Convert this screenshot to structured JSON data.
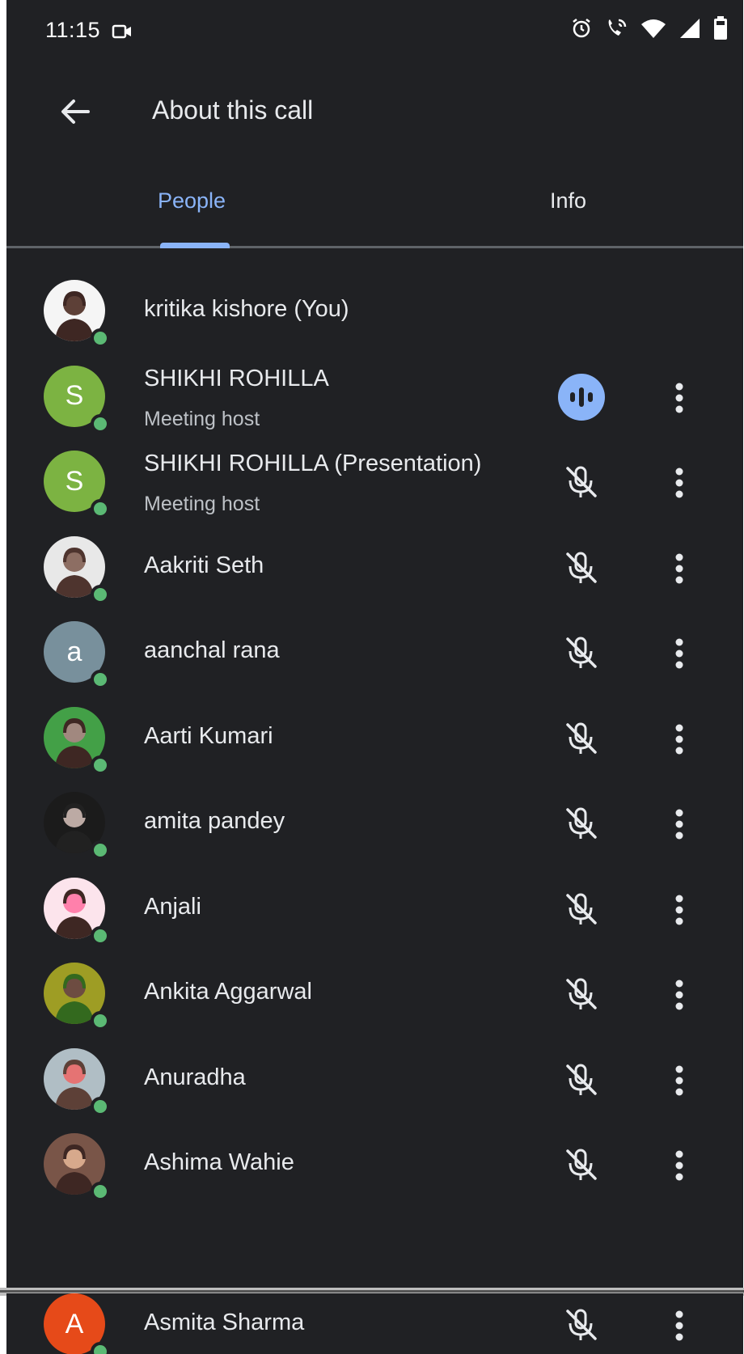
{
  "status_bar": {
    "time": "11:15"
  },
  "app_bar": {
    "title": "About this call"
  },
  "tabs": [
    {
      "label": "People",
      "selected": true
    },
    {
      "label": "Info",
      "selected": false
    }
  ],
  "colors": {
    "accent": "#8ab4f8",
    "online": "#5bb974",
    "background": "#202124"
  },
  "participants": [
    {
      "name": "kritika kishore (You)",
      "subtitle": "",
      "avatar": "photo",
      "mic": "none"
    },
    {
      "name": "SHIKHI ROHILLA",
      "subtitle": "Meeting host",
      "avatar": "S",
      "avatar_color": "#7cb342",
      "mic": "speaking"
    },
    {
      "name": "SHIKHI ROHILLA (Presentation)",
      "subtitle": "Meeting host",
      "avatar": "S",
      "avatar_color": "#7cb342",
      "mic": "muted"
    },
    {
      "name": "Aakriti Seth",
      "subtitle": "",
      "avatar": "photo",
      "mic": "muted"
    },
    {
      "name": "aanchal rana",
      "subtitle": "",
      "avatar": "a",
      "avatar_color": "#78909c",
      "mic": "muted"
    },
    {
      "name": "Aarti Kumari",
      "subtitle": "",
      "avatar": "photo",
      "mic": "muted"
    },
    {
      "name": "amita pandey",
      "subtitle": "",
      "avatar": "photo",
      "mic": "muted"
    },
    {
      "name": "Anjali",
      "subtitle": "",
      "avatar": "photo",
      "mic": "muted"
    },
    {
      "name": "Ankita Aggarwal",
      "subtitle": "",
      "avatar": "photo",
      "mic": "muted"
    },
    {
      "name": "Anuradha",
      "subtitle": "",
      "avatar": "photo",
      "mic": "muted"
    },
    {
      "name": "Ashima Wahie",
      "subtitle": "",
      "avatar": "photo",
      "mic": "muted"
    },
    {
      "name": "Asmita Sharma",
      "subtitle": "",
      "avatar": "A",
      "avatar_color": "#e64a19",
      "mic": "muted"
    }
  ]
}
